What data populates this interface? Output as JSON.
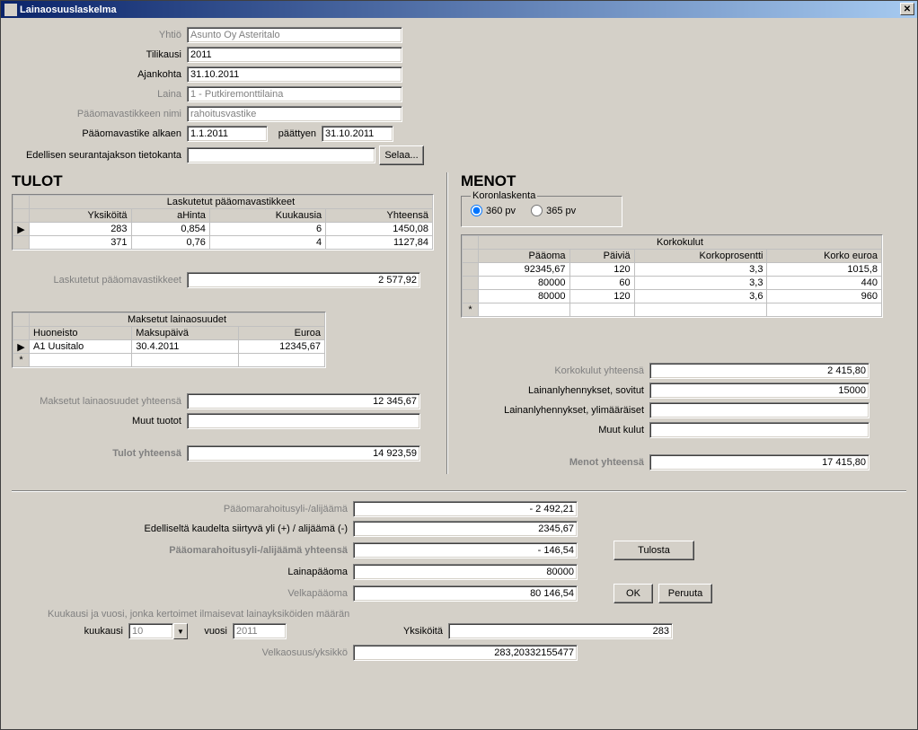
{
  "title": "Lainaosuuslaskelma",
  "hdr": {
    "yhtio_lbl": "Yhtiö",
    "yhtio": "Asunto Oy Asteritalo",
    "tilikausi_lbl": "Tilikausi",
    "tilikausi": "2011",
    "ajankohta_lbl": "Ajankohta",
    "ajankohta": "31.10.2011",
    "laina_lbl": "Laina",
    "laina": "1 - Putkiremonttilaina",
    "pvn_lbl": "Pääomavastikkeen nimi",
    "pvn": "rahoitusvastike",
    "pva_lbl": "Pääomavastike alkaen",
    "pva": "1.1.2011",
    "paattyen_lbl": "päättyen",
    "paattyen": "31.10.2011",
    "edel_lbl": "Edellisen seurantajakson tietokanta",
    "edel": "",
    "selaa": "Selaa..."
  },
  "tulot": {
    "title": "TULOT",
    "lasktitle": "Laskutetut pääomavastikkeet",
    "cols": {
      "yk": "Yksiköitä",
      "ah": "aHinta",
      "kk": "Kuukausia",
      "yh": "Yhteensä"
    },
    "rows": [
      {
        "yk": "283",
        "ah": "0,854",
        "kk": "6",
        "yh": "1450,08"
      },
      {
        "yk": "371",
        "ah": "0,76",
        "kk": "4",
        "yh": "1127,84"
      }
    ],
    "laskyht_lbl": "Laskutetut pääomavastikkeet",
    "laskyht": "2 577,92",
    "makstitle": "Maksetut lainaosuudet",
    "mcols": {
      "h": "Huoneisto",
      "mp": "Maksupäivä",
      "e": "Euroa"
    },
    "mrows": [
      {
        "h": "A1 Uusitalo",
        "mp": "30.4.2011",
        "e": "12345,67"
      }
    ],
    "maksyht_lbl": "Maksetut lainaosuudet yhteensä",
    "maksyht": "12 345,67",
    "muut_lbl": "Muut tuotot",
    "muut": "",
    "tot_lbl": "Tulot yhteensä",
    "tot": "14 923,59"
  },
  "menot": {
    "title": "MENOT",
    "koron_lbl": "Koronlaskenta",
    "r360": "360 pv",
    "r365": "365 pv",
    "ktitle": "Korkokulut",
    "kcols": {
      "p": "Pääoma",
      "pv": "Päiviä",
      "kp": "Korkoprosentti",
      "ke": "Korko euroa"
    },
    "krows": [
      {
        "p": "92345,67",
        "pv": "120",
        "kp": "3,3",
        "ke": "1015,8"
      },
      {
        "p": "80000",
        "pv": "60",
        "kp": "3,3",
        "ke": "440"
      },
      {
        "p": "80000",
        "pv": "120",
        "kp": "3,6",
        "ke": "960"
      }
    ],
    "kyht_lbl": "Korkokulut yhteensä",
    "kyht": "2 415,80",
    "sov_lbl": "Lainanlyhennykset, sovitut",
    "sov": "15000",
    "yli_lbl": "Lainanlyhennykset, ylimääräiset",
    "yli": "",
    "muut_lbl": "Muut kulut",
    "muut": "",
    "tot_lbl": "Menot yhteensä",
    "tot": "17 415,80"
  },
  "footer": {
    "pya_lbl": "Pääomarahoitusyli-/alijäämä",
    "pya": "- 2 492,21",
    "edk_lbl": "Edelliseltä kaudelta siirtyvä yli (+) / alijäämä (-)",
    "edk": "2345,67",
    "pyay_lbl": "Pääomarahoitusyli-/alijäämä yhteensä",
    "pyay": "- 146,54",
    "lp_lbl": "Lainapääoma",
    "lp": "80000",
    "vp_lbl": "Velkapääoma",
    "vp": "80 146,54",
    "kv_lbl": "Kuukausi ja vuosi, jonka kertoimet ilmaisevat lainayksiköiden määrän",
    "kk_lbl": "kuukausi",
    "kk": "10",
    "vuosi_lbl": "vuosi",
    "vuosi": "2011",
    "yk_lbl": "Yksiköitä",
    "yk": "283",
    "vy_lbl": "Velkaosuus/yksikkö",
    "vy": "283,20332155477",
    "tulosta": "Tulosta",
    "ok": "OK",
    "peruuta": "Peruuta"
  }
}
